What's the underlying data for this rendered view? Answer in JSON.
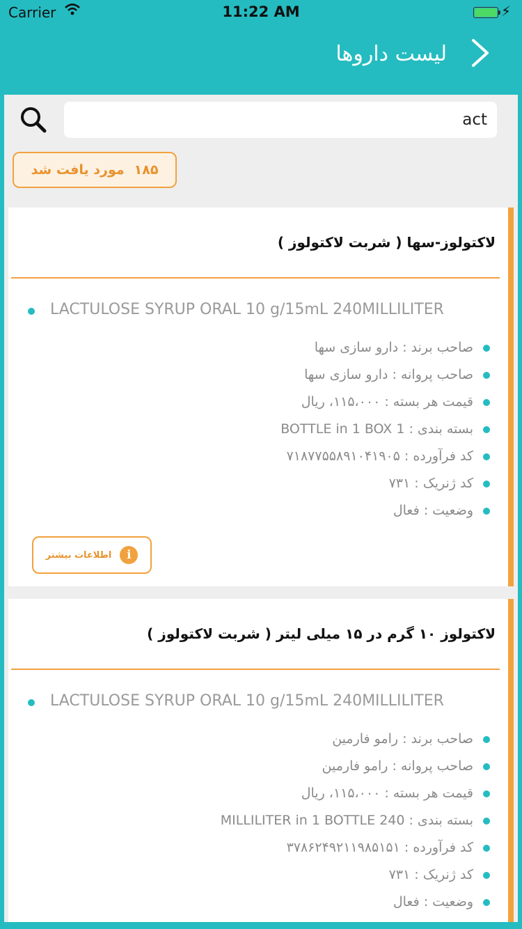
{
  "status_bar": {
    "carrier": "Carrier",
    "time": "11:22 AM"
  },
  "header": {
    "title": "لیست داروها"
  },
  "search": {
    "value": "act",
    "found_count": "۱۸۵",
    "found_label": "مورد یافت شد"
  },
  "colors": {
    "teal": "#24bcc1",
    "orange": "#f2a13f"
  },
  "cards": [
    {
      "title": "لاکتولوز-سها ( شربت لاکتولوز )",
      "latin_name": "LACTULOSE SYRUP ORAL 10 g/15mL 240MILLILITER",
      "properties": [
        "صاحب برند : دارو سازی سها",
        "صاحب پروانه : دارو سازی سها",
        "قیمت هر بسته : ۱۱۵،۰۰۰، ریال",
        "بسته بندی : 1 BOTTLE in 1 BOX",
        "کد فرآورده : ۷۱۸۷۷۵۵۸۹۱۰۴۱۹۰۵",
        "کد ژنریک : ۷۳۱",
        "وضعیت : فعال"
      ],
      "more_info": "اطلاعات بیشتر"
    },
    {
      "title": "لاکتولوز ۱۰ گرم  در  ۱۵ میلی لیتر ( شربت لاکتولوز )",
      "latin_name": "LACTULOSE SYRUP ORAL 10 g/15mL 240MILLILITER",
      "properties": [
        "صاحب برند : رامو فارمین",
        "صاحب پروانه : رامو فارمین",
        "قیمت هر بسته : ۱۱۵،۰۰۰، ریال",
        "بسته بندی : 240 MILLILITER in 1 BOTTLE",
        "کد فرآورده : ۳۷۸۶۲۴۹۲۱۱۹۸۵۱۵۱",
        "کد ژنریک : ۷۳۱",
        "وضعیت : فعال"
      ]
    }
  ]
}
